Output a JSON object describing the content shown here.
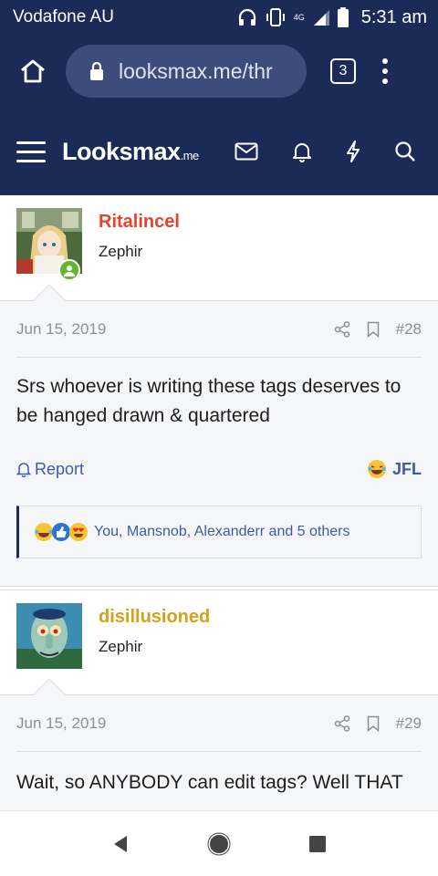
{
  "status": {
    "carrier": "Vodafone AU",
    "network": "4G",
    "time": "5:31 am"
  },
  "browser": {
    "url": "looksmax.me/thr",
    "tab_count": "3"
  },
  "site": {
    "logo": "Looksmax",
    "logo_suffix": ".me"
  },
  "posts": [
    {
      "username": "Ritalincel",
      "user_title": "Zephir",
      "date": "Jun 15, 2019",
      "number": "#28",
      "message": "Srs whoever is writing these tags deserves to be hanged drawn & quartered",
      "report_label": "Report",
      "reaction_label": "JFL",
      "reactions_summary": "You, Mansnob, Alexanderr and 5 others",
      "username_color": "#e6432c"
    },
    {
      "username": "disillusioned",
      "user_title": "Zephir",
      "date": "Jun 15, 2019",
      "number": "#29",
      "message": "Wait, so ANYBODY can edit tags? Well THAT",
      "username_color": "#d3a21a"
    }
  ],
  "colors": {
    "header": "#1b2b58",
    "link": "#3d5aa8",
    "online": "#63b62f"
  }
}
